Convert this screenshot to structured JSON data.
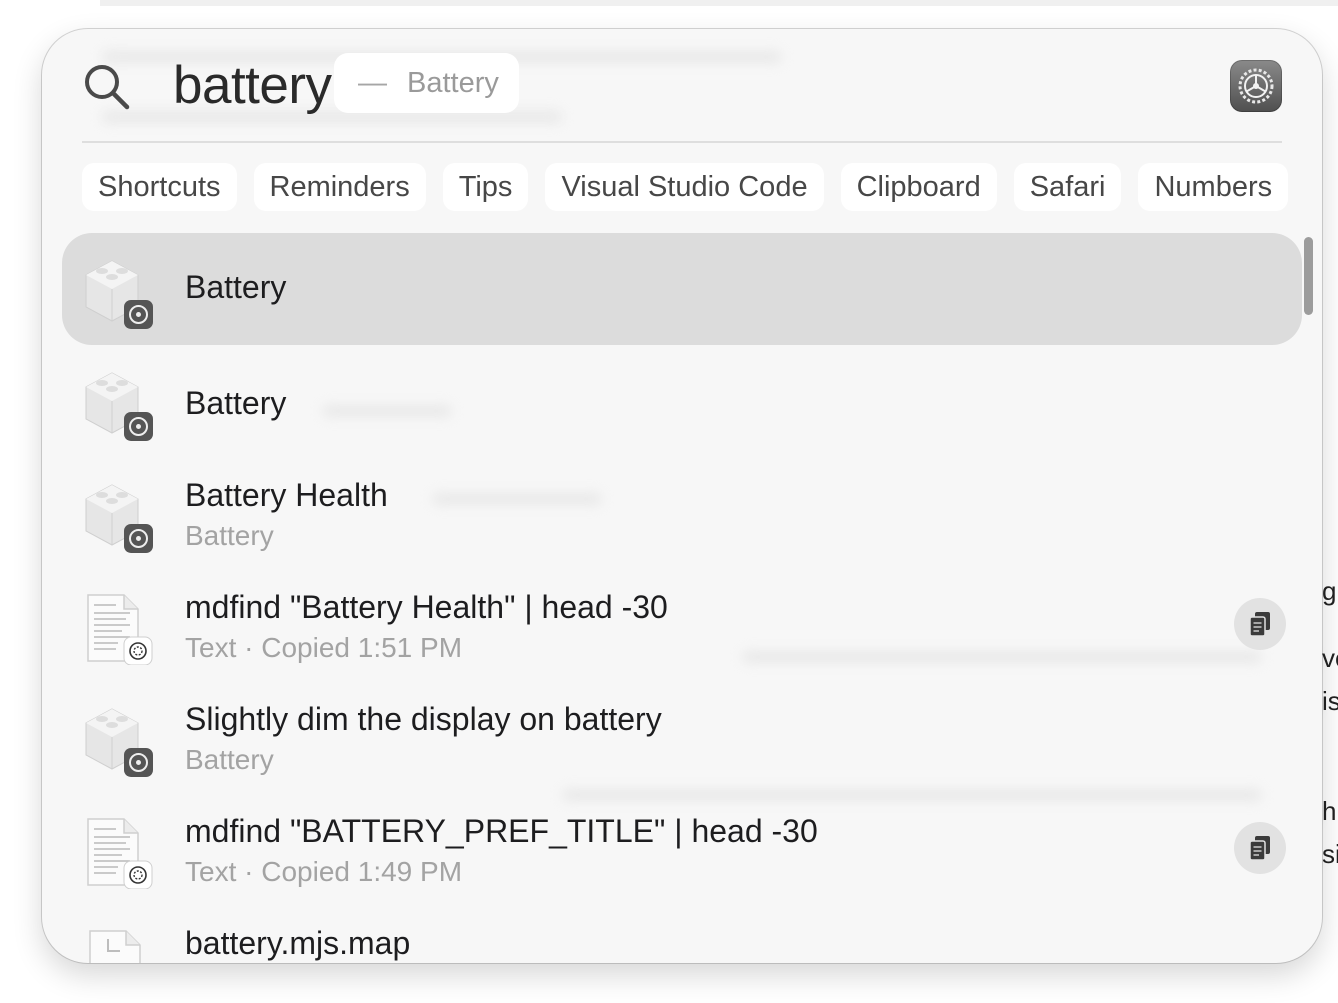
{
  "background": {
    "edge_fragments": [
      "g a",
      "ve",
      "is",
      "hi",
      "si"
    ]
  },
  "spotlight": {
    "query": "battery",
    "completion_dash": "—",
    "completion_text": "Battery",
    "settings_icon": "gear-icon",
    "chips": [
      "Shortcuts",
      "Reminders",
      "Tips",
      "Visual Studio Code",
      "Clipboard",
      "Safari",
      "Numbers"
    ],
    "results": [
      {
        "title": "Battery",
        "subtitle": "",
        "icon": "preference-pane-icon",
        "selected": true,
        "action": ""
      },
      {
        "title": "Battery",
        "subtitle": "",
        "icon": "preference-pane-icon",
        "selected": false,
        "action": ""
      },
      {
        "title": "Battery Health",
        "subtitle": "Battery",
        "icon": "preference-pane-icon",
        "selected": false,
        "action": ""
      },
      {
        "title": "mdfind \"Battery Health\" | head -30",
        "subtitle": "Text · Copied 1:51 PM",
        "icon": "text-document-icon",
        "selected": false,
        "action": "copy-icon"
      },
      {
        "title": "Slightly dim the display on battery",
        "subtitle": "Battery",
        "icon": "preference-pane-icon",
        "selected": false,
        "action": ""
      },
      {
        "title": "mdfind \"BATTERY_PREF_TITLE\" | head -30",
        "subtitle": "Text · Copied 1:49 PM",
        "icon": "text-document-icon",
        "selected": false,
        "action": "copy-icon"
      },
      {
        "title": "battery.mjs.map",
        "subtitle": "",
        "icon": "generic-file-icon",
        "selected": false,
        "action": ""
      }
    ]
  },
  "colors": {
    "panel_bg": "#f7f7f7",
    "selected_row": "#dcdcdc",
    "subtitle_text": "#a3a3a3",
    "chip_bg": "#ffffff"
  }
}
